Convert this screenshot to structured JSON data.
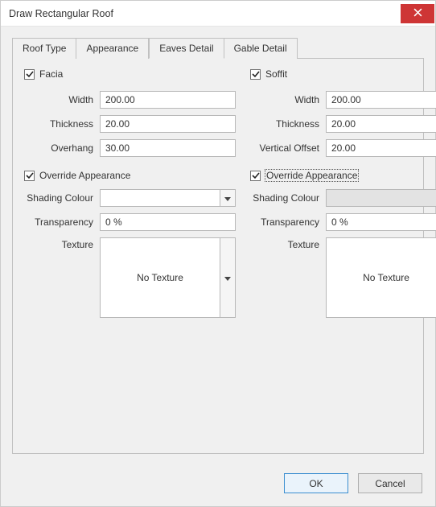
{
  "title": "Draw Rectangular Roof",
  "tabs": {
    "roof_type": "Roof Type",
    "appearance": "Appearance",
    "eaves_detail": "Eaves Detail",
    "gable_detail": "Gable Detail"
  },
  "facia": {
    "label": "Facia",
    "checked": true,
    "width_label": "Width",
    "width_value": "200.00",
    "thickness_label": "Thickness",
    "thickness_value": "20.00",
    "overhang_label": "Overhang",
    "overhang_value": "30.00",
    "override_label": "Override Appearance",
    "override_checked": true,
    "shading_label": "Shading Colour",
    "transparency_label": "Transparency",
    "transparency_value": "0 %",
    "texture_label": "Texture",
    "texture_value": "No Texture"
  },
  "soffit": {
    "label": "Soffit",
    "checked": true,
    "width_label": "Width",
    "width_value": "200.00",
    "thickness_label": "Thickness",
    "thickness_value": "20.00",
    "voffset_label": "Vertical Offset",
    "voffset_value": "20.00",
    "override_label": "Override Appearance",
    "override_checked": true,
    "shading_label": "Shading Colour",
    "transparency_label": "Transparency",
    "transparency_value": "0 %",
    "texture_label": "Texture",
    "texture_value": "No Texture"
  },
  "buttons": {
    "ok": "OK",
    "cancel": "Cancel"
  }
}
